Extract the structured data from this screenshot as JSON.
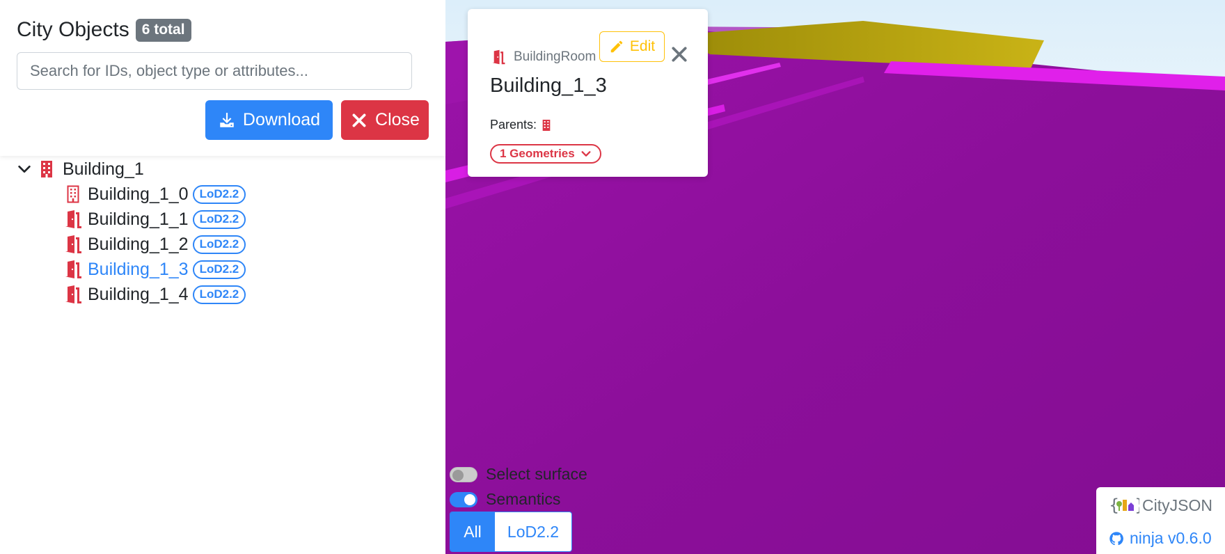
{
  "sidebar": {
    "title": "City Objects",
    "total_badge": "6 total",
    "search_placeholder": "Search for IDs, object type or attributes...",
    "download_label": "Download",
    "close_label": "Close"
  },
  "tree": {
    "root": {
      "label": "Building_1",
      "icon": "building-icon"
    },
    "children": [
      {
        "label": "Building_1_0",
        "lod": "LoD2.2",
        "icon": "building-icon"
      },
      {
        "label": "Building_1_1",
        "lod": "LoD2.2",
        "icon": "door-icon"
      },
      {
        "label": "Building_1_2",
        "lod": "LoD2.2",
        "icon": "door-icon"
      },
      {
        "label": "Building_1_3",
        "lod": "LoD2.2",
        "icon": "door-icon",
        "selected": true
      },
      {
        "label": "Building_1_4",
        "lod": "LoD2.2",
        "icon": "door-icon"
      }
    ]
  },
  "popup": {
    "object_type": "BuildingRoom",
    "edit_label": "Edit",
    "title": "Building_1_3",
    "parents_label": "Parents:",
    "geometries_label": "1 Geometries"
  },
  "viewer": {
    "select_surface_label": "Select surface",
    "select_surface_on": false,
    "semantics_label": "Semantics",
    "semantics_on": true,
    "lod_all_label": "All",
    "lod_22_label": "LoD2.2"
  },
  "footer": {
    "brand": "CityJSON",
    "version_link": "ninja v0.6.0"
  },
  "colors": {
    "primary": "#2e86f8",
    "danger": "#dc3545",
    "warning": "#ffc107",
    "secondary": "#6c757d",
    "surface_purple": "#8c0f9a",
    "roof_yellow": "#a8920c"
  }
}
